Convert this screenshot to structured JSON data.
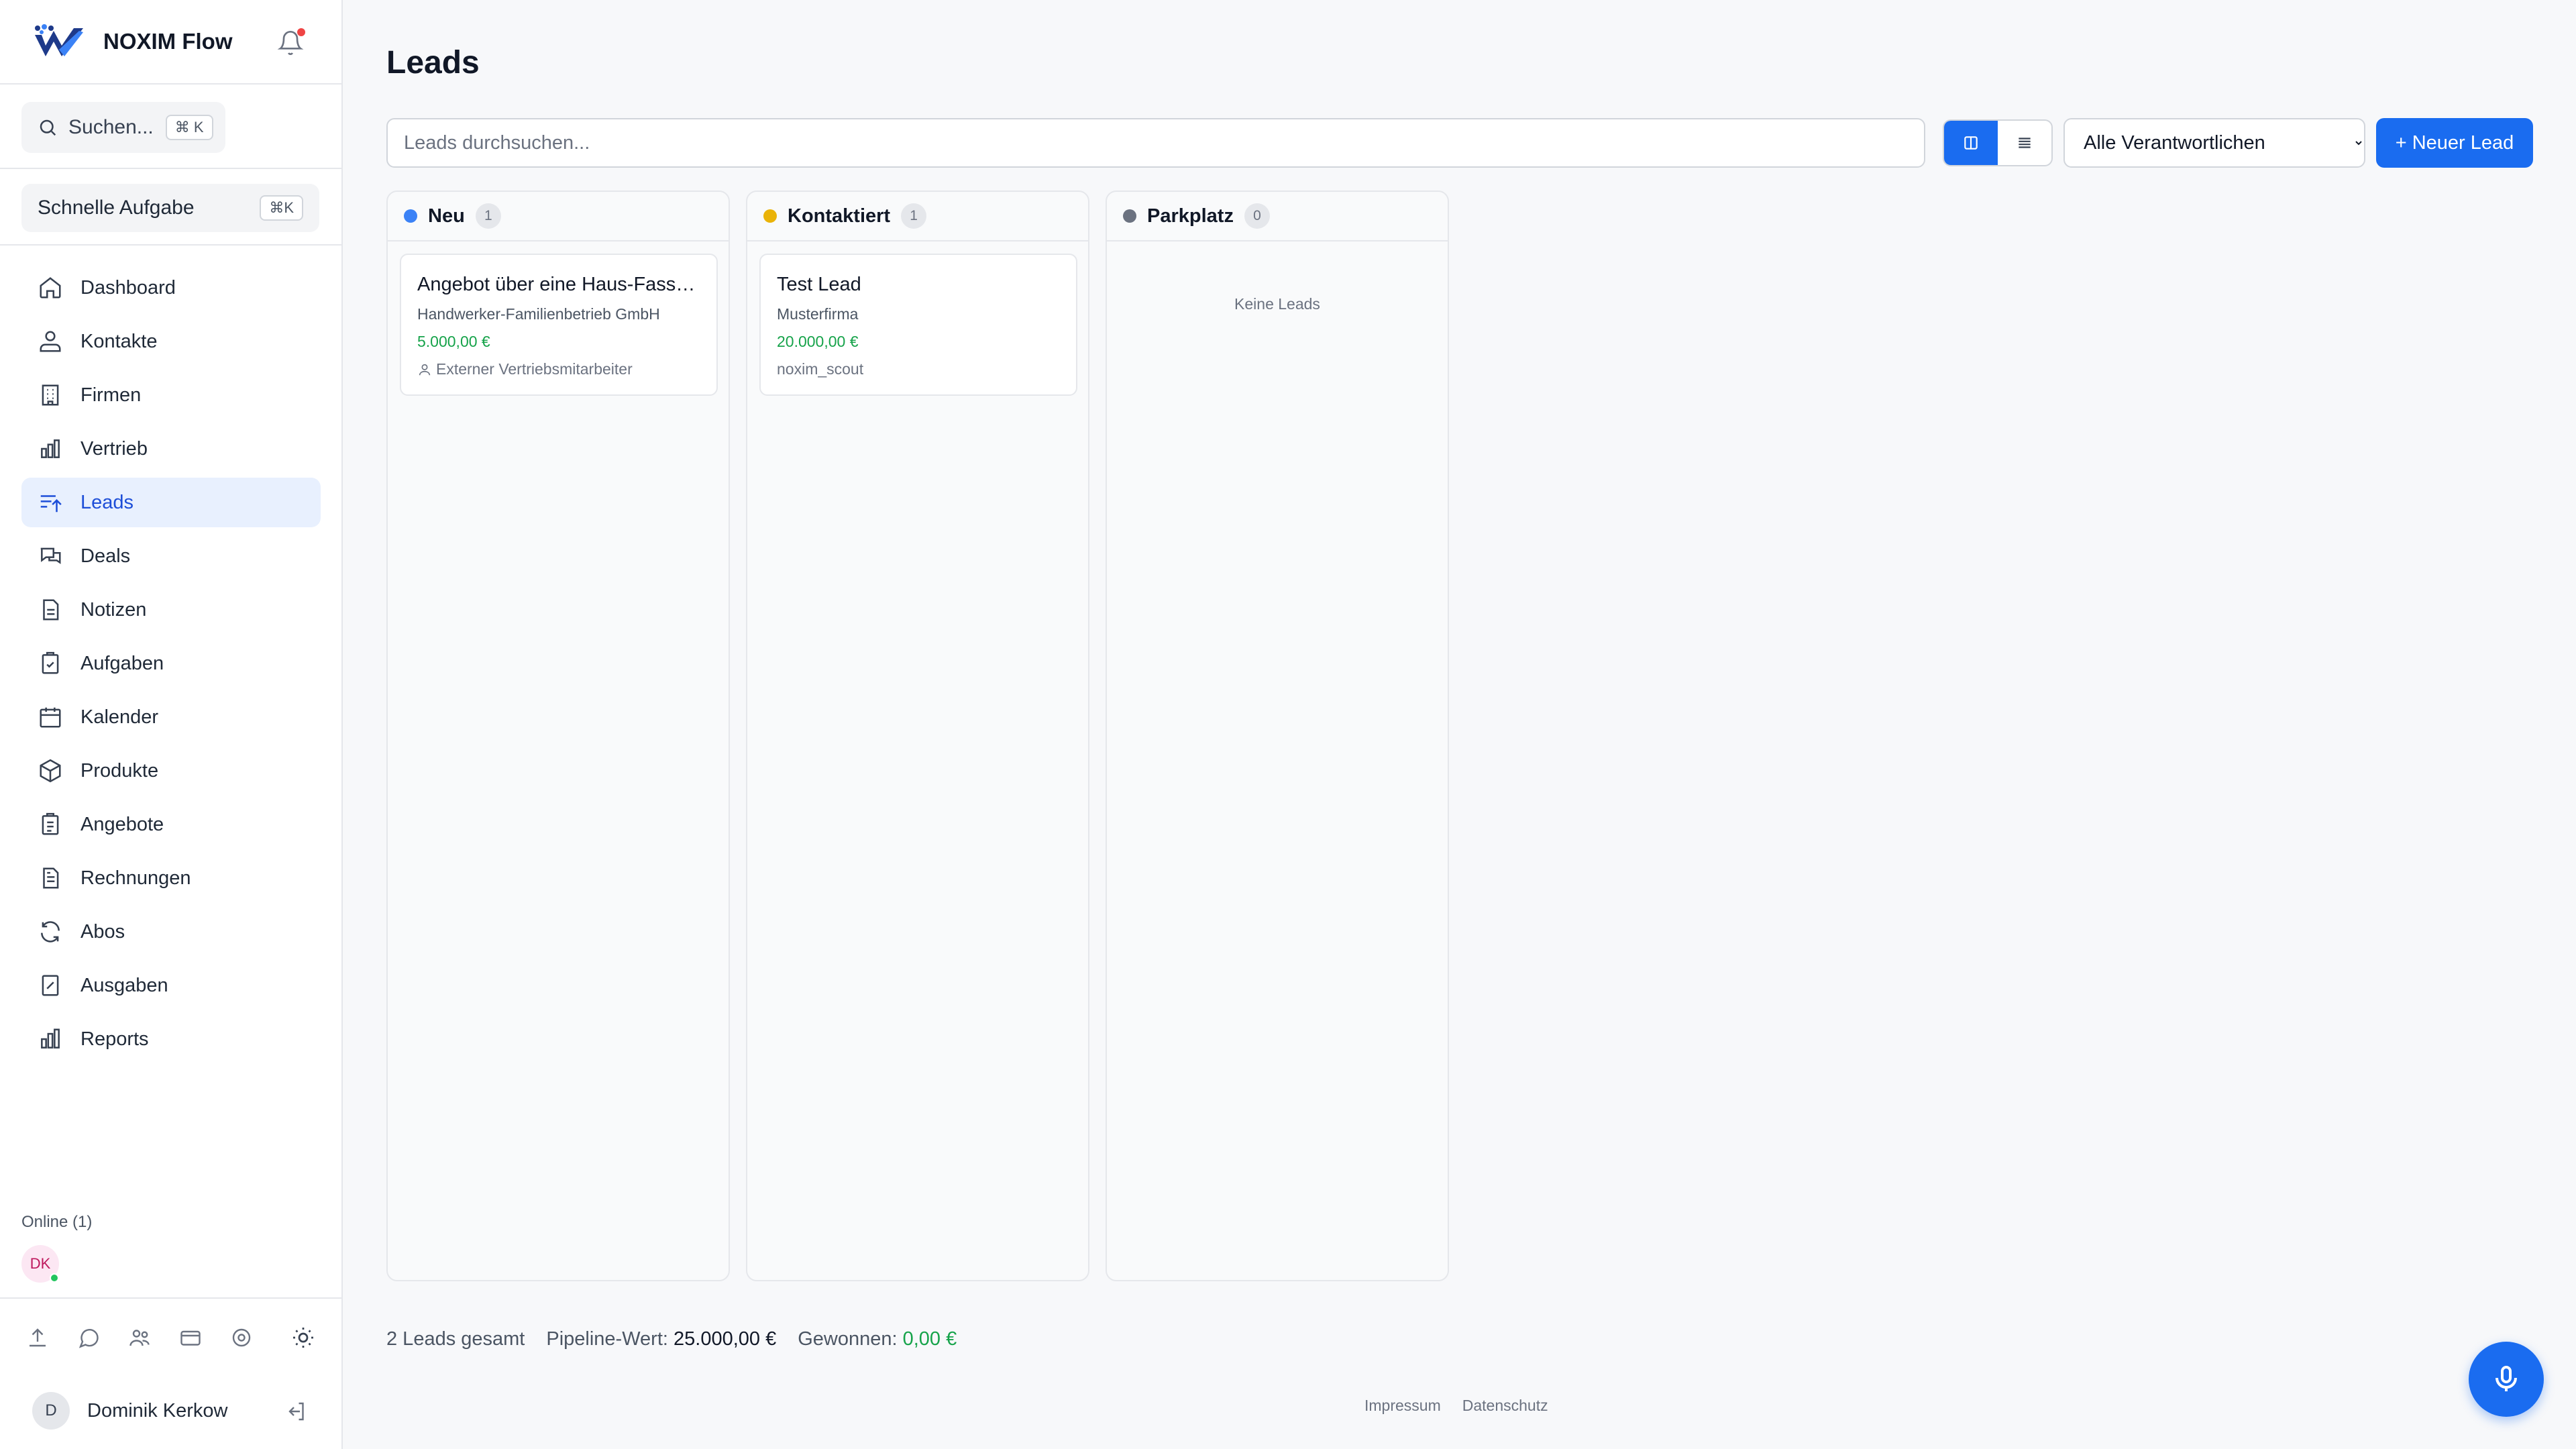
{
  "app": {
    "name": "NOXIM Flow"
  },
  "sidebar": {
    "search_label": "Suchen...",
    "search_shortcut": "⌘ K",
    "quick_task_label": "Schnelle Aufgabe",
    "quick_task_shortcut": "⌘K",
    "items": [
      {
        "label": "Dashboard",
        "icon": "home-icon",
        "active": false
      },
      {
        "label": "Kontakte",
        "icon": "contacts-icon",
        "active": false
      },
      {
        "label": "Firmen",
        "icon": "building-icon",
        "active": false
      },
      {
        "label": "Vertrieb",
        "icon": "bar-chart-icon",
        "active": false
      },
      {
        "label": "Leads",
        "icon": "leads-icon",
        "active": true
      },
      {
        "label": "Deals",
        "icon": "chat-bubbles-icon",
        "active": false
      },
      {
        "label": "Notizen",
        "icon": "document-icon",
        "active": false
      },
      {
        "label": "Aufgaben",
        "icon": "clipboard-check-icon",
        "active": false
      },
      {
        "label": "Kalender",
        "icon": "calendar-icon",
        "active": false
      },
      {
        "label": "Produkte",
        "icon": "box-icon",
        "active": false
      },
      {
        "label": "Angebote",
        "icon": "clipboard-icon",
        "active": false
      },
      {
        "label": "Rechnungen",
        "icon": "invoice-icon",
        "active": false
      },
      {
        "label": "Abos",
        "icon": "refresh-icon",
        "active": false
      },
      {
        "label": "Ausgaben",
        "icon": "receipt-icon",
        "active": false
      },
      {
        "label": "Reports",
        "icon": "reports-icon",
        "active": false
      }
    ],
    "online_label": "Online (1)",
    "online_users": [
      "DK"
    ],
    "user": {
      "initial": "D",
      "name": "Dominik Kerkow"
    }
  },
  "main": {
    "title": "Leads",
    "search_placeholder": "Leads durchsuchen...",
    "owner_filter": {
      "selected": "Alle Verantwortlichen"
    },
    "new_lead_label": "+ Neuer Lead",
    "columns": [
      {
        "title": "Neu",
        "count": "1",
        "color": "#3b82f6",
        "cards": [
          {
            "title": "Angebot über eine Haus-Fassadensanierung",
            "company": "Handwerker-Familienbetrieb GmbH",
            "value": "5.000,00 €",
            "owner": "Externer Vertriebsmitarbeiter"
          }
        ]
      },
      {
        "title": "Kontaktiert",
        "count": "1",
        "color": "#eab308",
        "cards": [
          {
            "title": "Test Lead",
            "company": "Musterfirma",
            "value": "20.000,00 €",
            "owner": "noxim_scout"
          }
        ]
      },
      {
        "title": "Parkplatz",
        "count": "0",
        "color": "#6b7280",
        "cards": [],
        "empty_text": "Keine Leads"
      }
    ],
    "stats": {
      "total": "2 Leads gesamt",
      "pipeline_label": "Pipeline-Wert:",
      "pipeline_value": "25.000,00 €",
      "won_label": "Gewonnen:",
      "won_value": "0,00 €"
    },
    "footer_links": [
      "Impressum",
      "Datenschutz"
    ]
  }
}
